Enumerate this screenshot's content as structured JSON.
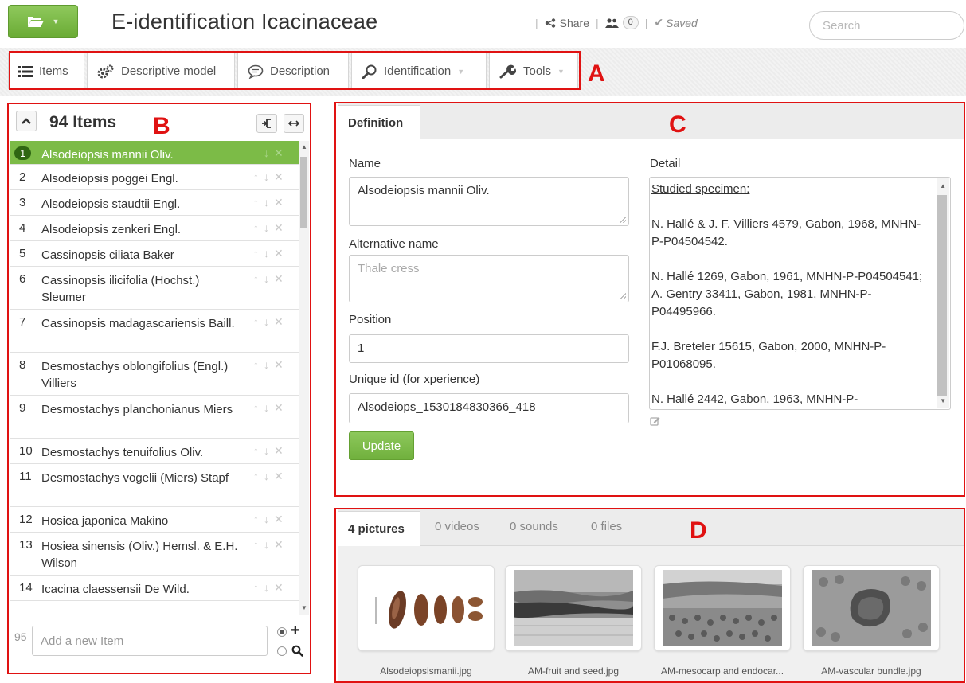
{
  "app": {
    "title": "E-identification Icacinaceae",
    "share_label": "Share",
    "collaborators_count": "0",
    "saved_label": "Saved",
    "search_placeholder": "Search"
  },
  "nav": {
    "tabs": [
      {
        "label": "Items",
        "icon": "list-icon"
      },
      {
        "label": "Descriptive model",
        "icon": "gears-icon"
      },
      {
        "label": "Description",
        "icon": "speech-bubble-icon"
      },
      {
        "label": "Identification",
        "icon": "magnifier-icon"
      },
      {
        "label": "Tools",
        "icon": "wrench-icon"
      }
    ]
  },
  "annotations": {
    "a": "A",
    "b": "B",
    "c": "C",
    "d": "D"
  },
  "items_panel": {
    "count_label": "94 Items",
    "items": [
      {
        "num": "1",
        "name": "Alsodeiopsis mannii Oliv."
      },
      {
        "num": "2",
        "name": "Alsodeiopsis poggei Engl."
      },
      {
        "num": "3",
        "name": "Alsodeiopsis staudtii Engl."
      },
      {
        "num": "4",
        "name": "Alsodeiopsis zenkeri Engl."
      },
      {
        "num": "5",
        "name": "Cassinopsis ciliata Baker"
      },
      {
        "num": "6",
        "name": "Cassinopsis ilicifolia (Hochst.) Sleumer"
      },
      {
        "num": "7",
        "name": "Cassinopsis madagascariensis Baill."
      },
      {
        "num": "8",
        "name": "Desmostachys oblongifolius (Engl.) Villiers"
      },
      {
        "num": "9",
        "name": "Desmostachys planchonianus Miers"
      },
      {
        "num": "10",
        "name": "Desmostachys tenuifolius Oliv."
      },
      {
        "num": "11",
        "name": "Desmostachys vogelii (Miers) Stapf"
      },
      {
        "num": "12",
        "name": "Hosiea japonica Makino"
      },
      {
        "num": "13",
        "name": "Hosiea sinensis (Oliv.) Hemsl. & E.H. Wilson"
      },
      {
        "num": "14",
        "name": "Icacina claessensii De Wild."
      }
    ],
    "new_item_number": "95",
    "new_item_placeholder": "Add a new Item"
  },
  "definition": {
    "tab_label": "Definition",
    "name_label": "Name",
    "name_value": "Alsodeiopsis mannii Oliv.",
    "alt_name_label": "Alternative name",
    "alt_name_placeholder": "Thale cress",
    "position_label": "Position",
    "position_value": "1",
    "unique_id_label": "Unique id (for xperience)",
    "unique_id_value": "Alsodeiops_1530184830366_418",
    "update_label": "Update",
    "detail_label": "Detail",
    "detail_heading": "Studied specimen:",
    "detail_paragraphs": [
      "N. Hallé & J. F. Villiers 4579, Gabon, 1968, MNHN-P-P04504542.",
      "N. Hallé 1269, Gabon, 1961, MNHN-P-P04504541; A. Gentry 33411, Gabon, 1981, MNHN-P-P04495966.",
      "F.J. Breteler 15615, Gabon, 2000, MNHN-P-P01068095.",
      "N. Hallé 2442, Gabon, 1963, MNHN-P-"
    ]
  },
  "media": {
    "tabs": [
      {
        "label": "4 pictures"
      },
      {
        "label": "0 videos"
      },
      {
        "label": "0 sounds"
      },
      {
        "label": "0 files"
      }
    ],
    "pictures": [
      {
        "caption": "Alsodeiopsismanii.jpg"
      },
      {
        "caption": "AM-fruit and seed.jpg"
      },
      {
        "caption": "AM-mesocarp and endocar..."
      },
      {
        "caption": "AM-vascular bundle.jpg"
      }
    ]
  },
  "colors": {
    "accent": "#7cbb47",
    "annotation": "#e01212"
  }
}
